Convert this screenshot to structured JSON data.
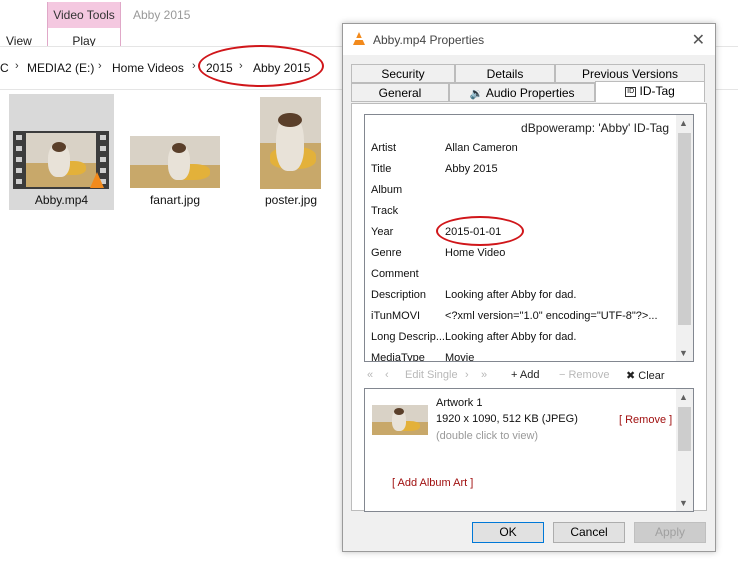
{
  "explorer": {
    "ribbon": {
      "view_tab": "View",
      "context_group": "Video Tools",
      "play_tab": "Play",
      "window_title": "Abby 2015"
    },
    "address": {
      "crumbs": [
        "C",
        "MEDIA2 (E:)",
        "Home Videos",
        "2015",
        "Abby 2015"
      ]
    },
    "files": [
      {
        "name": "Abby.mp4",
        "kind": "video"
      },
      {
        "name": "fanart.jpg",
        "kind": "image"
      },
      {
        "name": "poster.jpg",
        "kind": "image"
      }
    ]
  },
  "dialog": {
    "title": "Abby.mp4 Properties",
    "icons": {
      "app": "vlc-cone-icon",
      "close": "close-icon"
    },
    "tabs_top": [
      "Security",
      "Details",
      "Previous Versions"
    ],
    "tabs_bottom": [
      "General",
      "Audio Properties",
      "ID-Tag"
    ],
    "active_tab": "ID-Tag",
    "id_tag": {
      "header": "dBpoweramp: 'Abby' ID-Tag",
      "rows": [
        {
          "label": "Artist",
          "value": "Allan Cameron"
        },
        {
          "label": "Title",
          "value": "Abby 2015"
        },
        {
          "label": "Album",
          "value": ""
        },
        {
          "label": "Track",
          "value": ""
        },
        {
          "label": "Year",
          "value": "2015-01-01"
        },
        {
          "label": "Genre",
          "value": "Home Video"
        },
        {
          "label": "Comment",
          "value": ""
        },
        {
          "label": "Description",
          "value": "Looking after Abby for dad."
        },
        {
          "label": "iTunMOVI",
          "value": "<?xml version=\"1.0\" encoding=\"UTF-8\"?>..."
        },
        {
          "label": "Long Descrip...",
          "value": "Looking after Abby for dad."
        },
        {
          "label": "MediaType",
          "value": "Movie"
        }
      ]
    },
    "toolbar": {
      "first": "«",
      "prev": "‹",
      "edit_single": "Edit Single",
      "next": "›",
      "last": "»",
      "add": "+ Add",
      "remove": "− Remove",
      "clear": "✖ Clear"
    },
    "artwork": {
      "title": "Artwork 1",
      "info": "1920 x 1090, 512 KB  (JPEG)",
      "hint": "(double click to view)",
      "remove": "[ Remove ]",
      "add_album_art": "[ Add Album Art ]"
    },
    "buttons": {
      "ok": "OK",
      "cancel": "Cancel",
      "apply": "Apply"
    }
  },
  "colors": {
    "annotation": "#d0161a",
    "context_tab": "#f4c8e0",
    "link_red": "#a01010",
    "vlc_orange": "#f28a1c"
  }
}
